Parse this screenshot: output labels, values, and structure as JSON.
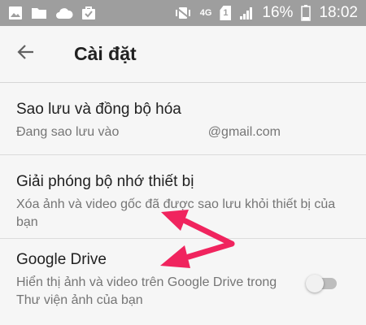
{
  "status_bar": {
    "icons_left": [
      "image-icon",
      "folder-icon",
      "cloud-icon",
      "shopping-bag-check-icon"
    ],
    "network": "4G",
    "sim": "1",
    "battery": "16%",
    "time": "18:02"
  },
  "app_bar": {
    "back_icon": "arrow-back-icon",
    "title": "Cài đặt"
  },
  "settings": {
    "backup": {
      "title": "Sao lưu và đồng bộ hóa",
      "subtitle_prefix": "Đang sao lưu vào",
      "subtitle_suffix": "@gmail.com"
    },
    "free_space": {
      "title": "Giải phóng bộ nhớ thiết bị",
      "subtitle": "Xóa ảnh và video gốc đã được sao lưu khỏi thiết bị của bạn"
    },
    "google_drive": {
      "title": "Google Drive",
      "subtitle": "Hiển thị ảnh và video trên Google Drive trong Thư viện ảnh của bạn",
      "toggle_on": false
    }
  },
  "annotation_color": "#f0245e",
  "colors": {
    "status_bar": "#9e9e9e",
    "background": "#f6f6f6",
    "title_text": "#212121",
    "secondary_text": "#757575"
  }
}
